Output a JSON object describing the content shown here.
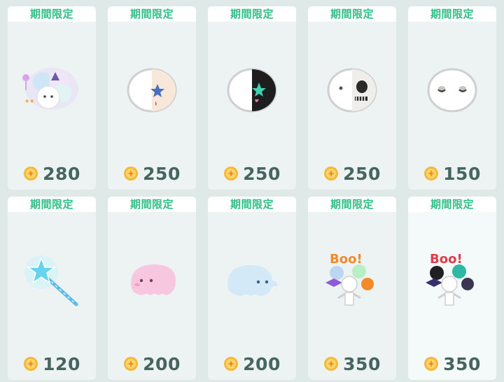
{
  "colors": {
    "background": "#dfe9e8",
    "card": "#edf3f3",
    "tag_text": "#2fbf86",
    "price_text": "#47655f",
    "coin": "#f5b93a"
  },
  "items": [
    {
      "tag": "期間限定",
      "price": "280",
      "icon": "ghost-friends-bundle-icon"
    },
    {
      "tag": "期間限定",
      "price": "250",
      "icon": "half-face-star-mask-icon"
    },
    {
      "tag": "期間限定",
      "price": "250",
      "icon": "black-half-face-mask-icon"
    },
    {
      "tag": "期間限定",
      "price": "250",
      "icon": "skull-half-face-mask-icon"
    },
    {
      "tag": "期間限定",
      "price": "150",
      "icon": "sleepy-face-mask-icon"
    },
    {
      "tag": "期間限定",
      "price": "120",
      "icon": "star-wand-icon"
    },
    {
      "tag": "期間限定",
      "price": "200",
      "icon": "pink-ghost-icon"
    },
    {
      "tag": "期間限定",
      "price": "200",
      "icon": "blue-ghost-icon"
    },
    {
      "tag": "期間限定",
      "price": "350",
      "icon": "boo-balloons-icon"
    },
    {
      "tag": "期間限定",
      "price": "350",
      "icon": "dark-boo-balloons-icon"
    }
  ]
}
